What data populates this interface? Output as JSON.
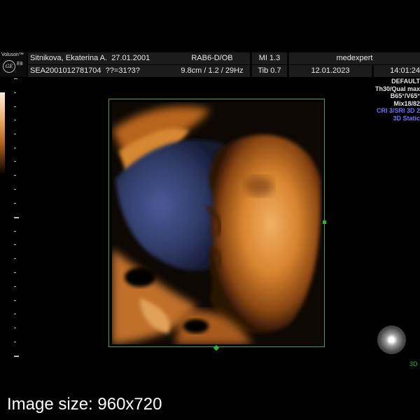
{
  "brand": {
    "name": "Voluson™",
    "logo": "GE",
    "probe": "E8"
  },
  "header": {
    "patient_name": "Sitnikova, Ekaterina A.",
    "dob": "27.01.2001",
    "probe_mode": "RAB6-D/OB",
    "mi": "MI  1.3",
    "institution": "medexpert",
    "patient_id": "SEA2001012781704",
    "ga": "??=31?3?",
    "depth_freq": "9.8cm / 1.2 / 29Hz",
    "tib": "Tib  0.7",
    "date": "12.01.2023",
    "time": "14:01:24"
  },
  "side_params": {
    "preset": "DEFAULT",
    "quality": "Th30/Qual max",
    "angles": "B65°/V65°",
    "mix": "Mix18/82",
    "cri": "CRI 3/SRI 3D 2",
    "mode": "3D Static"
  },
  "view_label": "3D",
  "caption": "Image size: 960x720",
  "colors": {
    "roi_frame": "#2fb22f",
    "tissue": "#d0802f",
    "shadow": "#3a4578",
    "param_blue": "#6f73ff"
  },
  "icons": {
    "orientation": "orientation-sphere-icon",
    "logo": "ge-logo-icon"
  }
}
